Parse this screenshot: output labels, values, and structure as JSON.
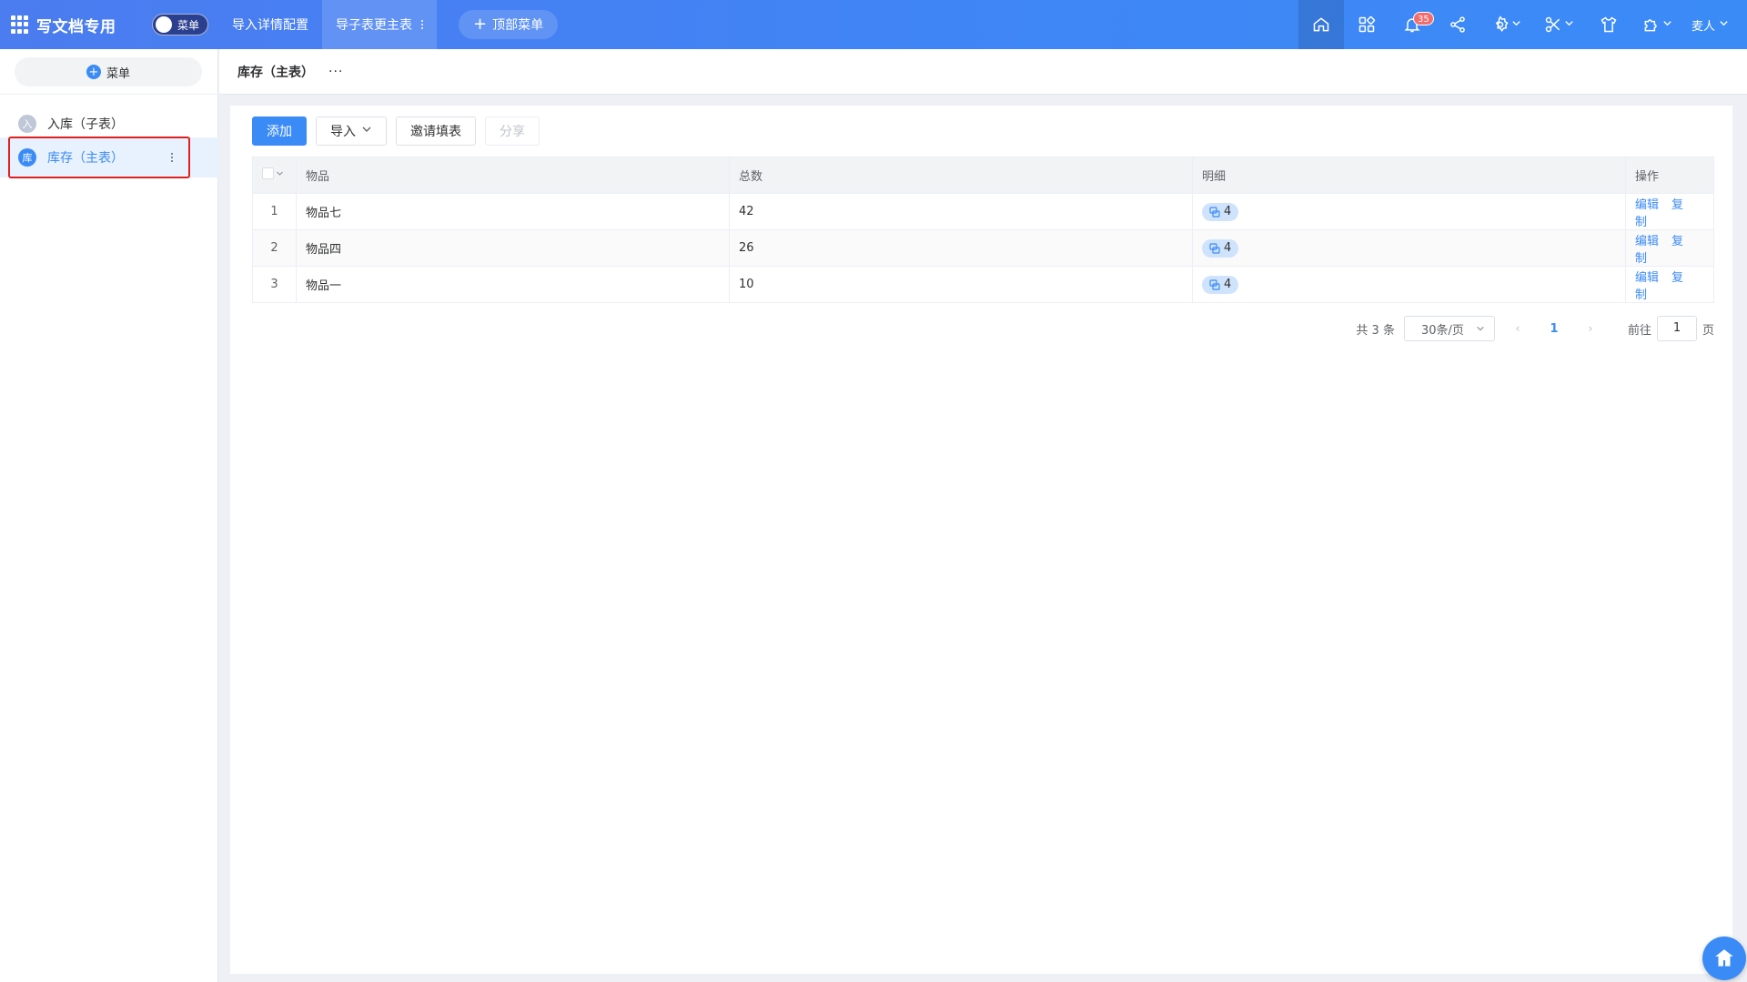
{
  "app": {
    "title": "写文档专用",
    "menu_toggle_label": "菜单"
  },
  "topnav": {
    "items": [
      {
        "label": "导入详情配置"
      },
      {
        "label": "导子表更主表"
      }
    ],
    "add_label": "顶部菜单",
    "notification_count": "35",
    "user_name": "麦人"
  },
  "sidebar": {
    "add_menu_label": "菜单",
    "items": [
      {
        "avatar": "入",
        "label": "入库（子表）"
      },
      {
        "avatar": "库",
        "label": "库存（主表）"
      }
    ]
  },
  "page": {
    "title": "库存（主表）",
    "more": "···"
  },
  "toolbar": {
    "add": "添加",
    "import": "导入",
    "invite": "邀请填表",
    "share": "分享"
  },
  "table": {
    "headers": [
      "物品",
      "总数",
      "明细",
      "操作"
    ],
    "rows": [
      {
        "idx": "1",
        "item": "物品七",
        "total": "42",
        "detail": "4",
        "edit": "编辑",
        "copy": "复制"
      },
      {
        "idx": "2",
        "item": "物品四",
        "total": "26",
        "detail": "4",
        "edit": "编辑",
        "copy": "复制"
      },
      {
        "idx": "3",
        "item": "物品一",
        "total": "10",
        "detail": "4",
        "edit": "编辑",
        "copy": "复制"
      }
    ]
  },
  "pagination": {
    "total": "共 3 条",
    "page_size": "30条/页",
    "current": "1",
    "goto_label": "前往",
    "goto_value": "1",
    "page_suffix": "页"
  },
  "colors": {
    "primary": "#3b8bf7",
    "topbar": "#4b7cf0",
    "badge": "#f56c6c",
    "highlight": "#e02020"
  }
}
